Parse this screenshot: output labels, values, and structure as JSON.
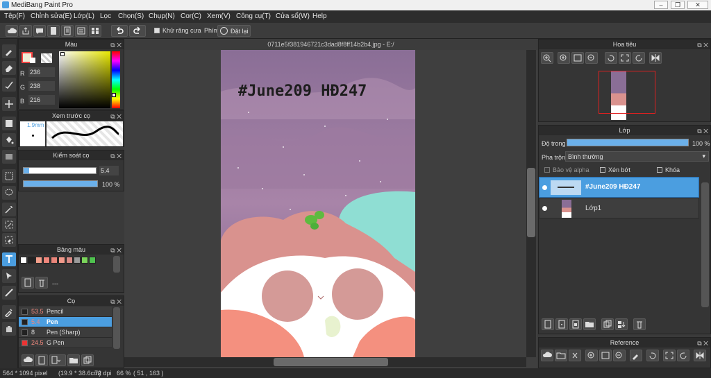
{
  "app": {
    "title": "MediBang Paint Pro"
  },
  "menu": [
    "Tệp(F)",
    "Chỉnh sửa(E)",
    "Lớp(L)",
    "Lọc",
    "Chọn(S)",
    "Chụp(N)",
    "Cor(C)",
    "Xem(V)",
    "Công cụ(T)",
    "Cửa sổ(W)",
    "Help"
  ],
  "toolbar": {
    "antialias_label": "Khử răng cưa",
    "key_label": "Phím",
    "reset_label": "Đặt lại"
  },
  "color_panel": {
    "title": "Màu",
    "r_label": "R",
    "g_label": "G",
    "b_label": "B",
    "r": "236",
    "g": "238",
    "b": "216",
    "current": "#ECEED8"
  },
  "brush_preview": {
    "title": "Xem trước cọ",
    "size": "1.9mm"
  },
  "brush_control": {
    "title": "Kiểm soát cọ",
    "size": "5.4",
    "opacity": "100 %",
    "opacity_fraction": 1.0
  },
  "palette": {
    "title": "Bảng màu",
    "colors": [
      "#ffffff",
      "#222222",
      "#f4a08c",
      "#f0877c",
      "#e9857a",
      "#f19a8b",
      "#d98a85",
      "#9a9a9a",
      "#7ad35a",
      "#4fc24f"
    ],
    "name": "---"
  },
  "brush_list": {
    "title": "Cọ",
    "items": [
      {
        "size": "53.5",
        "name": "Pencil",
        "selected": false,
        "color": "#f0877c"
      },
      {
        "size": "5.4",
        "name": "Pen",
        "selected": true,
        "color": "#f0877c"
      },
      {
        "size": "8",
        "name": "Pen (Sharp)",
        "selected": false,
        "color": "#dddddd"
      },
      {
        "size": "24.5",
        "name": "G Pen",
        "selected": false,
        "color": "#f0877c"
      }
    ]
  },
  "document": {
    "tab_title": "0711e5f381946721c3dad8f8ff14b2b4.jpg - E:/",
    "headline": "#June209 HĐ247"
  },
  "navigator": {
    "title": "Hoa tiêu"
  },
  "layers": {
    "title": "Lớp",
    "opacity_label": "Độ trong",
    "opacity": "100 %",
    "opacity_fraction": 1.0,
    "blend_label": "Pha trộn",
    "blend_value": "Bình thường",
    "protect_alpha": "Bảo vệ alpha",
    "clipping": "Xén bớt",
    "lock": "Khóa",
    "items": [
      {
        "name": "#June209 HĐ247",
        "selected": true
      },
      {
        "name": "Lớp1",
        "selected": false
      }
    ]
  },
  "reference": {
    "title": "Reference"
  },
  "status": {
    "size": "564 * 1094 pixel",
    "physical": "(19.9 * 38.6cm)",
    "dpi": "72 dpi",
    "zoom": "66 %",
    "coords": "( 51 , 163 )"
  }
}
